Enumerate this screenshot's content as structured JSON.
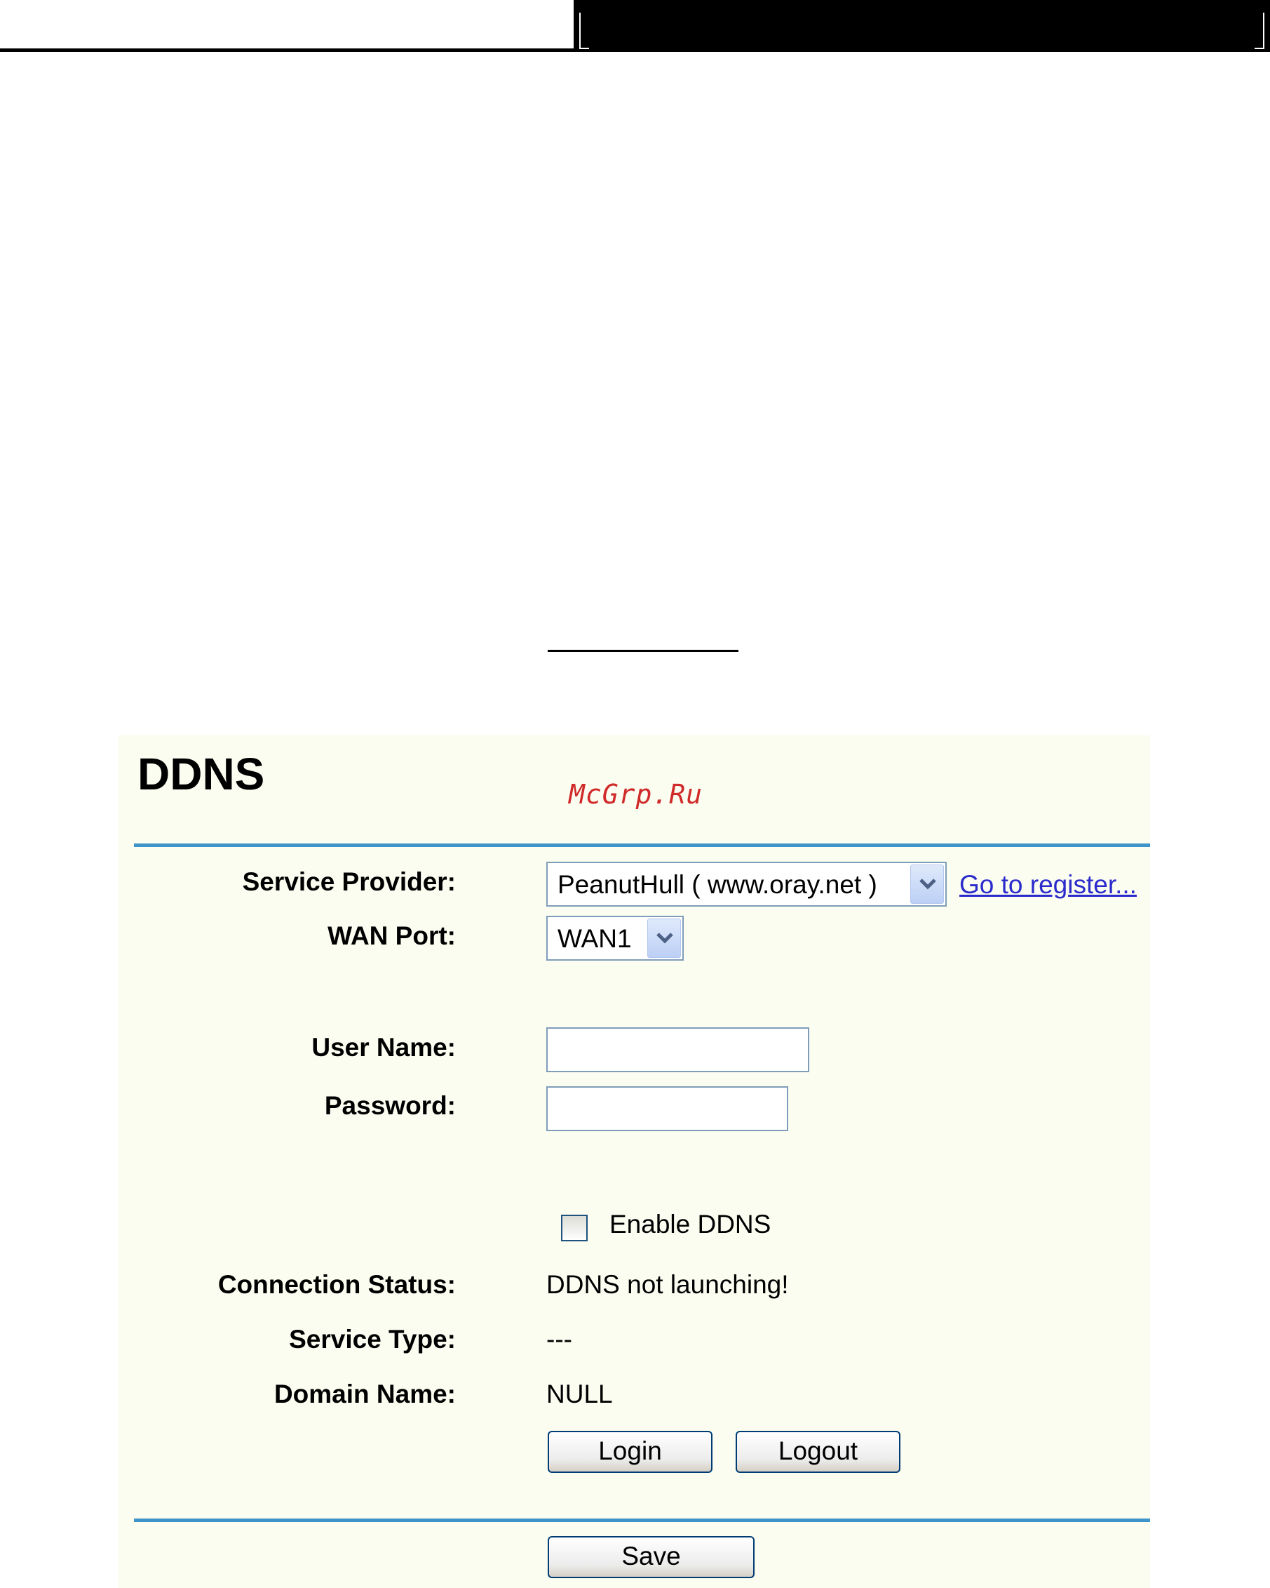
{
  "panel": {
    "title": "DDNS",
    "watermark": "McGrp.Ru"
  },
  "form": {
    "service_provider": {
      "label": "Service Provider:",
      "value": "PeanutHull ( www.oray.net )",
      "register_link": "Go to register..."
    },
    "wan_port": {
      "label": "WAN Port:",
      "value": "WAN1"
    },
    "user_name": {
      "label": "User Name:",
      "value": ""
    },
    "password": {
      "label": "Password:",
      "value": ""
    },
    "enable_ddns": {
      "label": "Enable DDNS",
      "checked": false
    },
    "connection_status": {
      "label": "Connection Status:",
      "value": "DDNS not launching!"
    },
    "service_type": {
      "label": "Service Type:",
      "value": "---"
    },
    "domain_name": {
      "label": "Domain Name:",
      "value": "NULL"
    }
  },
  "buttons": {
    "login": "Login",
    "logout": "Logout",
    "save": "Save"
  },
  "colors": {
    "panel_bg": "#fbfdf1",
    "rule": "#3e93c9",
    "link": "#2b2bcc",
    "watermark": "#d02a2a"
  }
}
